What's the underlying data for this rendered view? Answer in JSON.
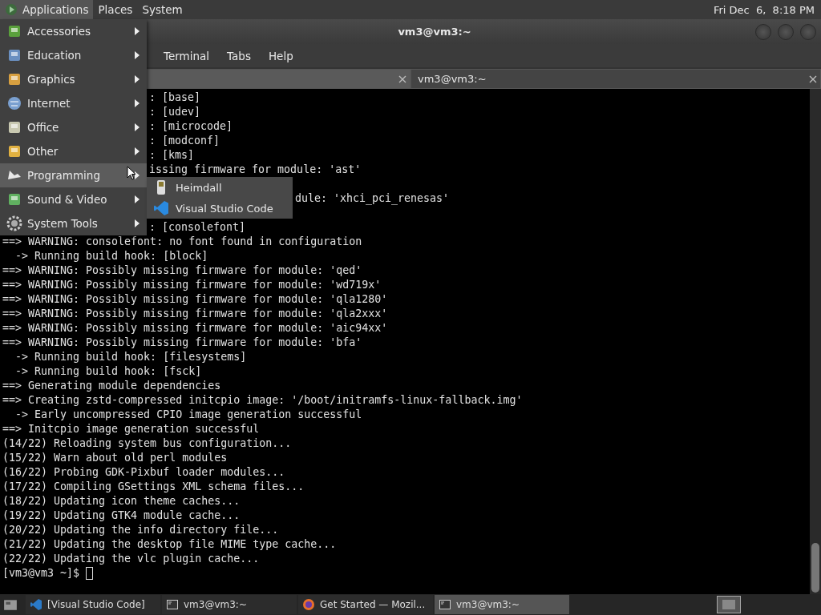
{
  "top_panel": {
    "menus": [
      {
        "label": "Applications",
        "selected": true
      },
      {
        "label": "Places",
        "selected": false
      },
      {
        "label": "System",
        "selected": false
      }
    ],
    "clock": "Fri Dec  6,  8:18 PM"
  },
  "window": {
    "title": "vm3@vm3:~"
  },
  "menubar": [
    "Terminal",
    "Tabs",
    "Help"
  ],
  "tabs": [
    {
      "selected": true
    },
    {
      "label": "vm3@vm3:~",
      "selected": false
    }
  ],
  "terminal": {
    "lines": [
      {
        "kind": "menu-cut",
        "text": ": [base]"
      },
      {
        "kind": "menu-cut",
        "text": ": [udev]"
      },
      {
        "kind": "menu-cut",
        "text": ": [microcode]"
      },
      {
        "kind": "menu-cut",
        "text": ": [modconf]"
      },
      {
        "kind": "menu-cut",
        "text": ": [kms]"
      },
      {
        "kind": "menu-cut",
        "text": "issing firmware for module: 'ast'"
      },
      {
        "kind": "submenu-cut",
        "text": "dule: 'xhci_pci_renesas'"
      },
      {
        "kind": "menu-cut-gap",
        "text": ": [consolefont]"
      },
      {
        "kind": "full",
        "text": "==> WARNING: consolefont: no font found in configuration"
      },
      {
        "kind": "full",
        "text": "  -> Running build hook: [block]"
      },
      {
        "kind": "full",
        "text": "==> WARNING: Possibly missing firmware for module: 'qed'"
      },
      {
        "kind": "full",
        "text": "==> WARNING: Possibly missing firmware for module: 'wd719x'"
      },
      {
        "kind": "full",
        "text": "==> WARNING: Possibly missing firmware for module: 'qla1280'"
      },
      {
        "kind": "full",
        "text": "==> WARNING: Possibly missing firmware for module: 'qla2xxx'"
      },
      {
        "kind": "full",
        "text": "==> WARNING: Possibly missing firmware for module: 'aic94xx'"
      },
      {
        "kind": "full",
        "text": "==> WARNING: Possibly missing firmware for module: 'bfa'"
      },
      {
        "kind": "full",
        "text": "  -> Running build hook: [filesystems]"
      },
      {
        "kind": "full",
        "text": "  -> Running build hook: [fsck]"
      },
      {
        "kind": "full",
        "text": "==> Generating module dependencies"
      },
      {
        "kind": "full",
        "text": "==> Creating zstd-compressed initcpio image: '/boot/initramfs-linux-fallback.img'"
      },
      {
        "kind": "full",
        "text": "  -> Early uncompressed CPIO image generation successful"
      },
      {
        "kind": "full",
        "text": "==> Initcpio image generation successful"
      },
      {
        "kind": "full",
        "text": "(14/22) Reloading system bus configuration..."
      },
      {
        "kind": "full",
        "text": "(15/22) Warn about old perl modules"
      },
      {
        "kind": "full",
        "text": "(16/22) Probing GDK-Pixbuf loader modules..."
      },
      {
        "kind": "full",
        "text": "(17/22) Compiling GSettings XML schema files..."
      },
      {
        "kind": "full",
        "text": "(18/22) Updating icon theme caches..."
      },
      {
        "kind": "full",
        "text": "(19/22) Updating GTK4 module cache..."
      },
      {
        "kind": "full",
        "text": "(20/22) Updating the info directory file..."
      },
      {
        "kind": "full",
        "text": "(21/22) Updating the desktop file MIME type cache..."
      },
      {
        "kind": "full",
        "text": "(22/22) Updating the vlc plugin cache..."
      }
    ],
    "prompt": "[vm3@vm3 ~]$ "
  },
  "applications_menu": [
    {
      "label": "Accessories",
      "selected": false
    },
    {
      "label": "Education",
      "selected": false
    },
    {
      "label": "Graphics",
      "selected": false
    },
    {
      "label": "Internet",
      "selected": false
    },
    {
      "label": "Office",
      "selected": false
    },
    {
      "label": "Other",
      "selected": false
    },
    {
      "label": "Programming",
      "selected": true
    },
    {
      "label": "Sound & Video",
      "selected": false
    },
    {
      "label": "System Tools",
      "selected": false
    }
  ],
  "submenu": [
    {
      "label": "Heimdall"
    },
    {
      "label": "Visual Studio Code"
    }
  ],
  "taskbar": [
    {
      "label": "[Visual Studio Code]",
      "selected": false
    },
    {
      "label": "vm3@vm3:~",
      "selected": false
    },
    {
      "label": "Get Started — Mozil...",
      "selected": false
    },
    {
      "label": "vm3@vm3:~",
      "selected": true
    }
  ]
}
